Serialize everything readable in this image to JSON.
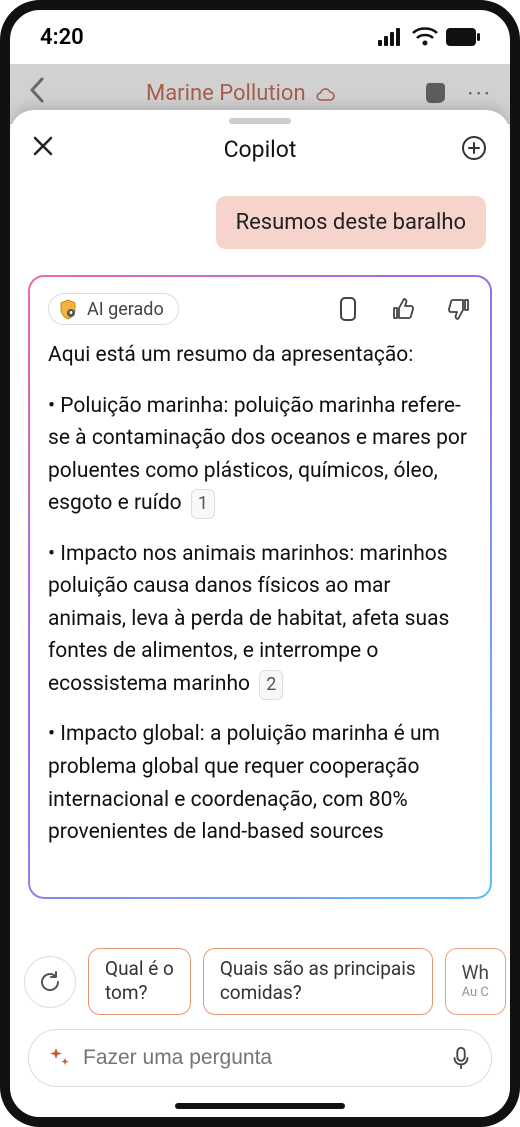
{
  "status": {
    "time": "4:20"
  },
  "app_bg": {
    "title": "Marine Pollution",
    "more_glyph": "···"
  },
  "sheet": {
    "title": "Copilot"
  },
  "user_message": "Resumos deste baralho",
  "ai": {
    "badge_label": "AI gerado",
    "intro": "Aqui está um resumo da apresentação:",
    "bullets": [
      {
        "text": "• Poluição marinha: poluição marinha refere-se à contaminação dos oceanos e mares por poluentes como plásticos, químicos, óleo, esgoto e ruído",
        "ref": "1"
      },
      {
        "text": "• Impacto nos animais marinhos: marinhos poluição causa danos físicos ao mar animais, leva à perda de habitat, afeta suas fontes de alimentos, e interrompe o ecossistema marinho",
        "ref": "2",
        "highlight_tail": "ecossistema marinho"
      },
      {
        "text": "• Impacto global: a poluição marinha é um problema global que requer cooperação internacional e coordenação, com 80% provenientes de land-based sources",
        "ref": ""
      }
    ]
  },
  "suggestions": [
    {
      "line1": "Qual é o",
      "line2": "tom?"
    },
    {
      "line1": "Quais são as principais",
      "line2": "comidas?"
    },
    {
      "line1": "Wh",
      "line2": "Au C"
    }
  ],
  "input": {
    "placeholder": "Fazer uma pergunta"
  }
}
